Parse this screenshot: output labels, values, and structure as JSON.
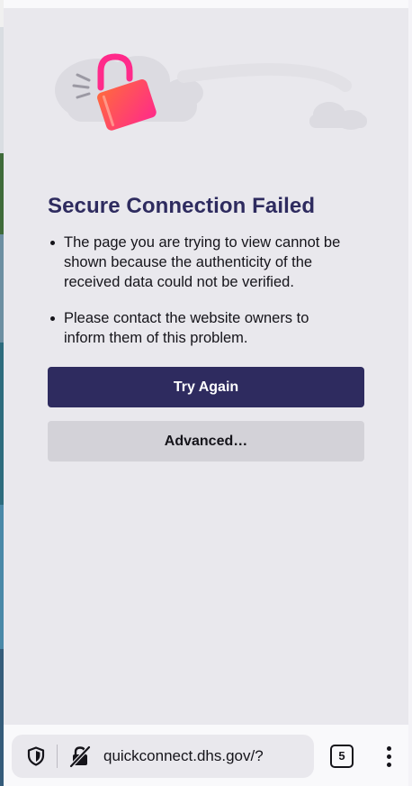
{
  "error": {
    "title": "Secure Connection Failed",
    "bullets": [
      "The page you are trying to view cannot be shown because the authenticity of the received data could not be verified.",
      "Please contact the website owners to inform them of this problem."
    ],
    "try_again_label": "Try Again",
    "advanced_label": "Advanced…"
  },
  "toolbar": {
    "url": "quickconnect.dhs.gov/?",
    "tab_count": "5",
    "icons": [
      "shield-icon",
      "insecure-lock-icon",
      "tabs-icon",
      "more-menu-icon"
    ]
  },
  "colors": {
    "page_background": "#e9e8ed",
    "title": "#2e2b5f",
    "primary_button": "#2e2b5f",
    "secondary_button": "#d3d2d8",
    "lock_gradient_start": "#ff4f5e",
    "lock_gradient_end": "#ff2a8a"
  }
}
